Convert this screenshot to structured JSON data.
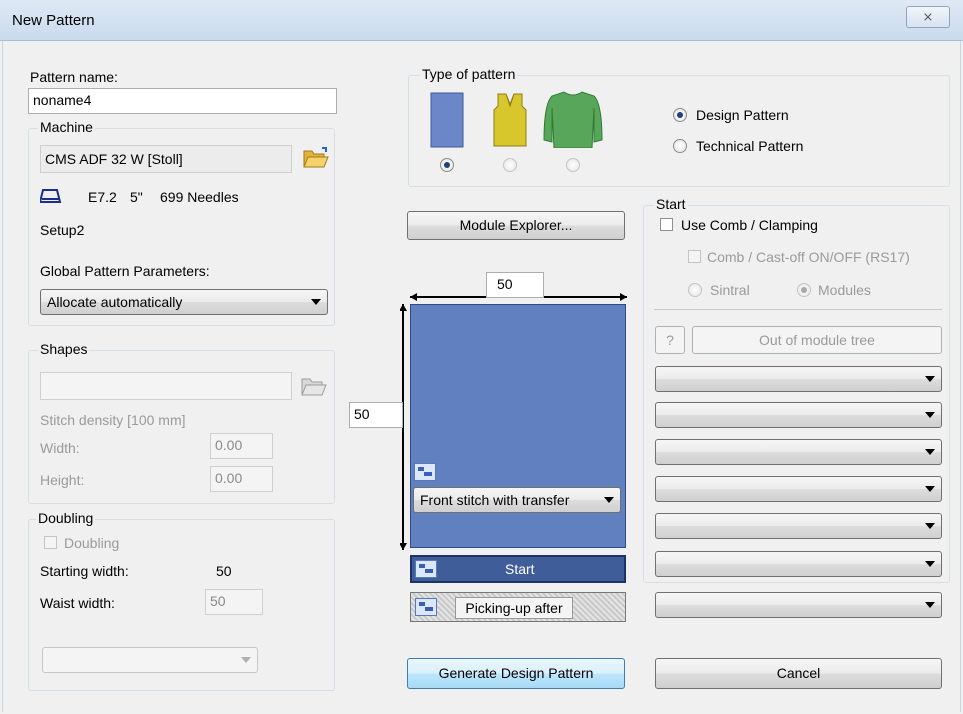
{
  "window": {
    "title": "New Pattern",
    "close_glyph": "⨯"
  },
  "pattern_name": {
    "label": "Pattern name:",
    "value": "noname4"
  },
  "machine": {
    "label": "Machine",
    "name": "CMS ADF 32 W [Stoll]",
    "gauge": "E7.2",
    "width_inch": "5\"",
    "needles": "699 Needles",
    "setup": "Setup2",
    "global_params_label": "Global Pattern Parameters:",
    "global_params_value": "Allocate automatically"
  },
  "shapes": {
    "label": "Shapes",
    "stitch_density_label": "Stitch density [100 mm]",
    "width_label": "Width:",
    "width_value": "0.00",
    "height_label": "Height:",
    "height_value": "0.00"
  },
  "doubling": {
    "label": "Doubling",
    "checkbox_label": "Doubling",
    "starting_width_label": "Starting width:",
    "starting_width_value": "50",
    "waist_width_label": "Waist width:",
    "waist_width_value": "50"
  },
  "type_of_pattern": {
    "label": "Type of pattern",
    "shapes": [
      "rectangle",
      "vest",
      "pullover"
    ],
    "selected_shape": 0,
    "design_pattern_label": "Design Pattern",
    "technical_pattern_label": "Technical Pattern",
    "selected_type": "Design Pattern"
  },
  "module_explorer_label": "Module Explorer...",
  "canvas": {
    "width_value": "50",
    "height_value": "50",
    "stitch_combo_value": "Front stitch with transfer",
    "start_bar_label": "Start",
    "picking_up_label": "Picking-up after",
    "pattern_color": "#6080c0"
  },
  "start": {
    "label": "Start",
    "use_comb_label": "Use Comb / Clamping",
    "comb_castoff_label": "Comb / Cast-off ON/OFF (RS17)",
    "sintral_label": "Sintral",
    "modules_label": "Modules",
    "help_label": "?",
    "out_of_module_tree_label": "Out of module tree"
  },
  "buttons": {
    "generate_label": "Generate Design Pattern",
    "cancel_label": "Cancel"
  }
}
